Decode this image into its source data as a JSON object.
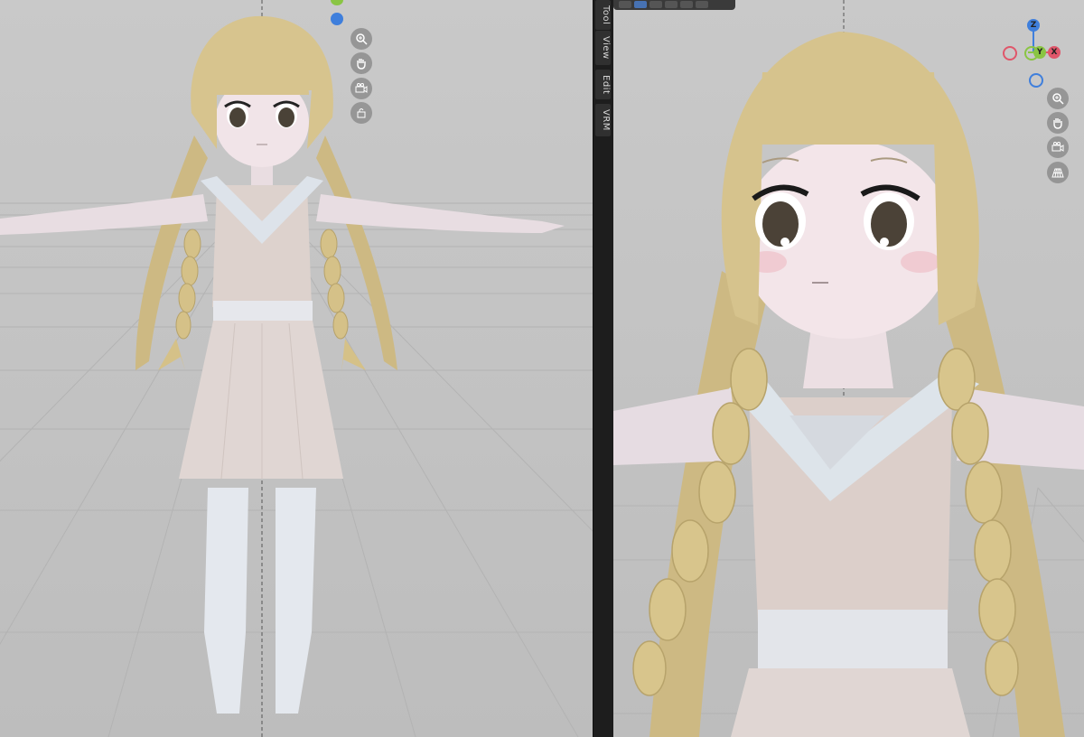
{
  "sidebar_tabs": [
    "Tool",
    "View",
    "Edit",
    "VRM"
  ],
  "left_view": {
    "nav_buttons": [
      "zoom-in-icon",
      "hand-pan-icon",
      "camera-icon",
      "lock-icon"
    ]
  },
  "right_view": {
    "gizmo": {
      "z_label": "Z",
      "x_label": "X",
      "y_label": "Y"
    },
    "nav_buttons": [
      "zoom-in-icon",
      "hand-pan-icon",
      "camera-icon",
      "grid-icon"
    ]
  },
  "colors": {
    "viewport_bg": "#c6c6c6",
    "hair": "#d7c48e",
    "skin": "#ece0e2",
    "dress": "#dcd2cd",
    "collar": "#dfe4ea",
    "x_axis": "#e0566a",
    "y_axis": "#8ac543",
    "z_axis": "#3f7fdc"
  }
}
